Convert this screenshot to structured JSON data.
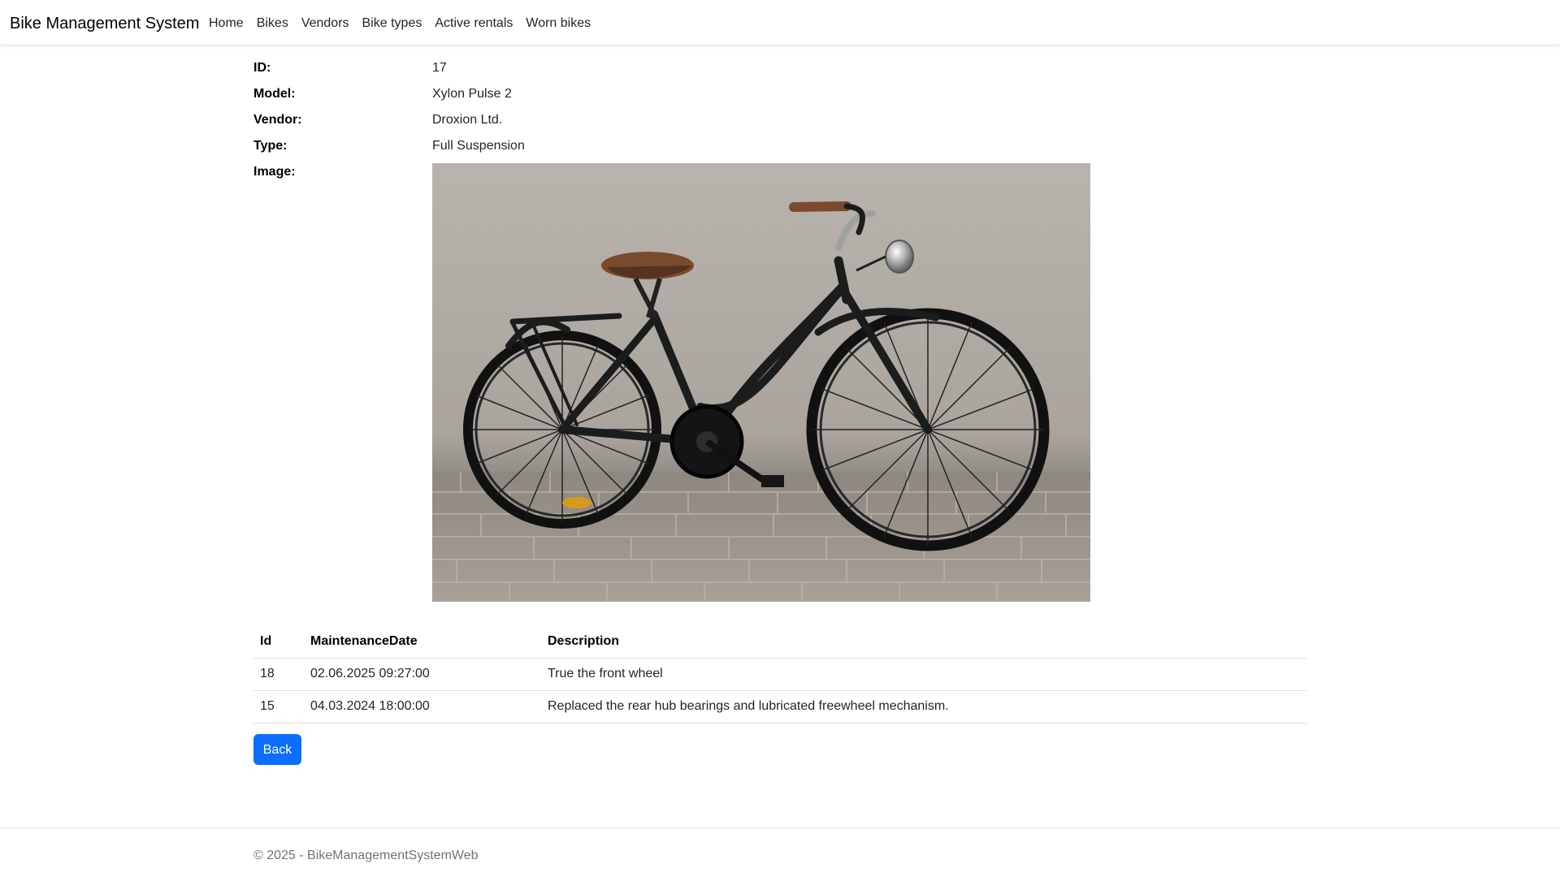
{
  "navbar": {
    "brand": "Bike Management System",
    "links": [
      "Home",
      "Bikes",
      "Vendors",
      "Bike types",
      "Active rentals",
      "Worn bikes"
    ]
  },
  "details": {
    "id_label": "ID:",
    "id_value": "17",
    "model_label": "Model:",
    "model_value": "Xylon Pulse 2",
    "vendor_label": "Vendor:",
    "vendor_value": "Droxion Ltd.",
    "type_label": "Type:",
    "type_value": "Full Suspension",
    "image_label": "Image:"
  },
  "maintenance": {
    "headers": {
      "id": "Id",
      "date": "MaintenanceDate",
      "description": "Description"
    },
    "rows": [
      {
        "id": "18",
        "date": "02.06.2025 09:27:00",
        "description": "True the front wheel"
      },
      {
        "id": "15",
        "date": "04.03.2024 18:00:00",
        "description": "Replaced the rear hub bearings and lubricated freewheel mechanism."
      }
    ]
  },
  "actions": {
    "back_label": "Back"
  },
  "footer": {
    "prefix": "© 2025 - ",
    "link": "BikeManagementSystemWeb"
  },
  "colors": {
    "primary": "#0d6efd",
    "text": "#212529",
    "muted": "#6c757d",
    "border": "#dee2e6"
  },
  "icons": {
    "bike_image": "bicycle-photo"
  }
}
